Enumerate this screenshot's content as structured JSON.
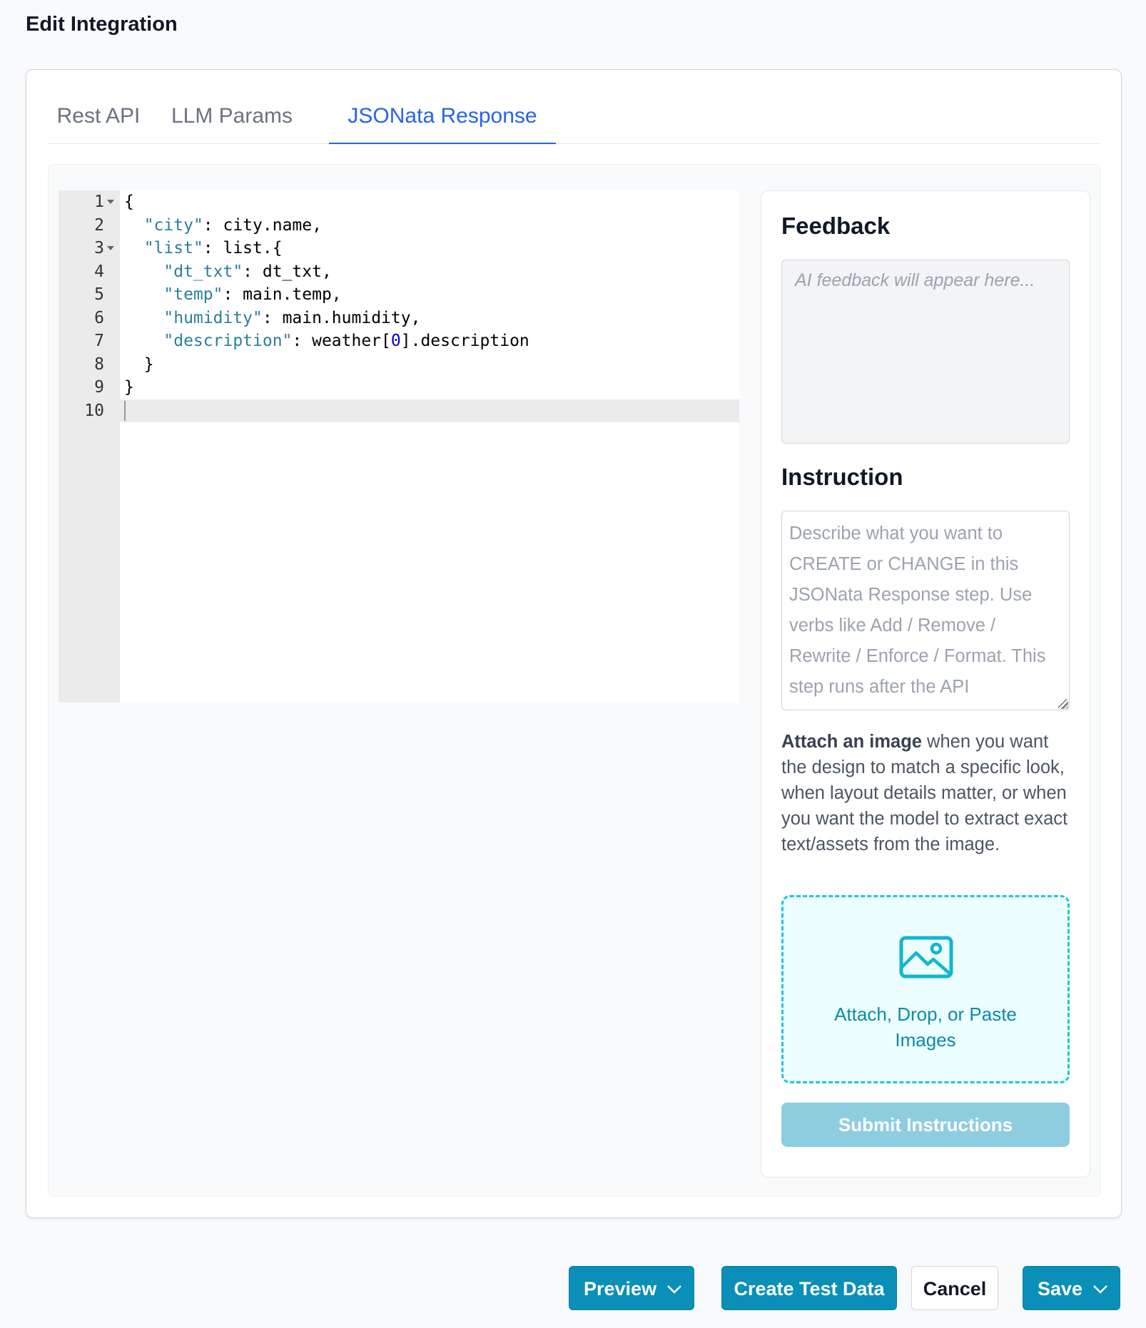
{
  "page": {
    "title": "Edit Integration"
  },
  "tabs": [
    {
      "label": "Rest API",
      "active": false
    },
    {
      "label": "LLM Params",
      "active": false
    },
    {
      "label": "JSONata Response",
      "active": true
    }
  ],
  "editor": {
    "lines": [
      {
        "number": "1",
        "foldable": true,
        "parts": [
          [
            "p",
            "{"
          ]
        ]
      },
      {
        "number": "2",
        "foldable": false,
        "parts": [
          [
            "p",
            "  "
          ],
          [
            "k",
            "\"city\""
          ],
          [
            "p",
            ": city.name,"
          ]
        ]
      },
      {
        "number": "3",
        "foldable": true,
        "parts": [
          [
            "p",
            "  "
          ],
          [
            "k",
            "\"list\""
          ],
          [
            "p",
            ": list.{"
          ]
        ]
      },
      {
        "number": "4",
        "foldable": false,
        "parts": [
          [
            "p",
            "    "
          ],
          [
            "k",
            "\"dt_txt\""
          ],
          [
            "p",
            ": dt_txt,"
          ]
        ]
      },
      {
        "number": "5",
        "foldable": false,
        "parts": [
          [
            "p",
            "    "
          ],
          [
            "k",
            "\"temp\""
          ],
          [
            "p",
            ": main.temp,"
          ]
        ]
      },
      {
        "number": "6",
        "foldable": false,
        "parts": [
          [
            "p",
            "    "
          ],
          [
            "k",
            "\"humidity\""
          ],
          [
            "p",
            ": main.humidity,"
          ]
        ]
      },
      {
        "number": "7",
        "foldable": false,
        "parts": [
          [
            "p",
            "    "
          ],
          [
            "k",
            "\"description\""
          ],
          [
            "p",
            ": weather["
          ],
          [
            "n",
            "0"
          ],
          [
            "p",
            "].description"
          ]
        ]
      },
      {
        "number": "8",
        "foldable": false,
        "parts": [
          [
            "p",
            "  }"
          ]
        ]
      },
      {
        "number": "9",
        "foldable": false,
        "parts": [
          [
            "p",
            "}"
          ]
        ]
      },
      {
        "number": "10",
        "foldable": false,
        "parts": []
      }
    ],
    "active_line": "10"
  },
  "feedback": {
    "heading": "Feedback",
    "placeholder": "AI feedback will appear here..."
  },
  "instruction": {
    "heading": "Instruction",
    "placeholder": "Describe what you want to CREATE or CHANGE in this JSONata Response step. Use verbs like Add / Remove / Rewrite / Enforce / Format. This step runs after the API"
  },
  "attach": {
    "bold": "Attach an image",
    "rest": " when you want the design to match a specific look, when layout details matter, or when you want the model to extract exact text/assets from the image.",
    "dropzone_label": "Attach, Drop, or Paste Images",
    "icon": "image-icon"
  },
  "submit_label": "Submit Instructions",
  "footer": {
    "preview_label": "Preview",
    "create_test_data_label": "Create Test Data",
    "cancel_label": "Cancel",
    "save_label": "Save"
  },
  "colors": {
    "accent": "#0a8fb8",
    "tab_active": "#2563eb",
    "dropzone_border": "#22c5d8",
    "submit_disabled": "#8ecde0"
  }
}
